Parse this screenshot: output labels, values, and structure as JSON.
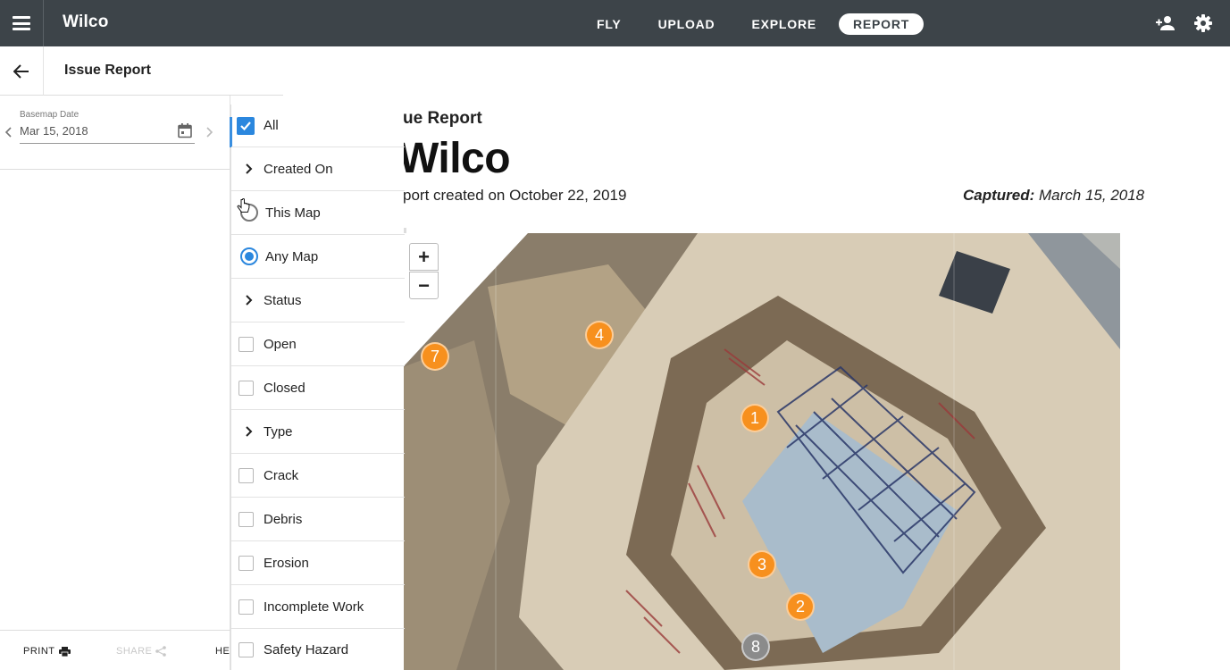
{
  "app": {
    "title": "Wilco"
  },
  "nav": {
    "items": [
      "FLY",
      "UPLOAD",
      "EXPLORE",
      "REPORT"
    ],
    "active": "REPORT"
  },
  "panel": {
    "title": "Issue Report",
    "basemap_label": "Basemap Date",
    "basemap_value": "Mar 15, 2018"
  },
  "footer": {
    "print": "PRINT",
    "share": "SHARE",
    "help": "HEL"
  },
  "filter": {
    "all": "All",
    "created_on": "Created On",
    "this_map": "This Map",
    "any_map": "Any Map",
    "status": "Status",
    "open": "Open",
    "closed": "Closed",
    "type": "Type",
    "crack": "Crack",
    "debris": "Debris",
    "erosion": "Erosion",
    "incomplete_work": "Incomplete Work",
    "safety_hazard": "Safety Hazard"
  },
  "report": {
    "subtitle": "ue Report",
    "title": "Wilco",
    "created": "port created on October 22, 2019",
    "captured_label": "Captured:",
    "captured_date": " March 15, 2018"
  },
  "map": {
    "zoom_in": "+",
    "zoom_out": "−",
    "markers": [
      "1",
      "2",
      "3",
      "4",
      "7",
      "8"
    ]
  },
  "colors": {
    "topbar": "#3d4449",
    "accent": "#2b87de",
    "marker": "#f7901e",
    "marker_closed": "#8b8b8b"
  }
}
